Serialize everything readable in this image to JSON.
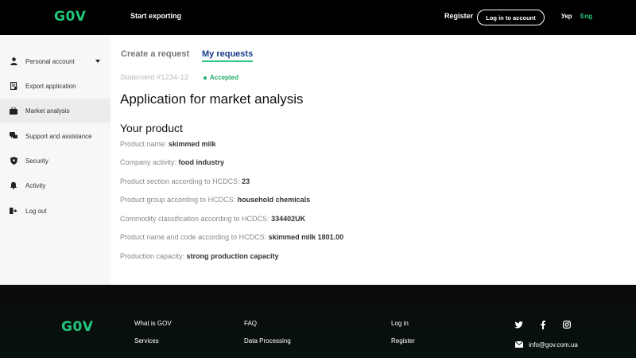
{
  "header": {
    "logo": "G0V",
    "nav_export": "Start exporting",
    "register": "Register",
    "login": "Log in to account",
    "lang_ukr": "Укр",
    "lang_eng": "Eng",
    "accent_color": "#22c47a"
  },
  "sidebar": {
    "items": [
      {
        "label": "Personal account",
        "icon": "person-icon"
      },
      {
        "label": "Export application",
        "icon": "document-icon"
      },
      {
        "label": "Market analysis",
        "icon": "briefcase-icon",
        "active": true
      },
      {
        "label": "Support and assistance",
        "icon": "chat-icon"
      },
      {
        "label": "Security",
        "icon": "shield-icon"
      },
      {
        "label": "Activity",
        "icon": "bell-icon"
      },
      {
        "label": "Log out",
        "icon": "logout-icon"
      }
    ]
  },
  "tabs": {
    "create": "Create a request",
    "my_requests": "My requests"
  },
  "statement": {
    "label": "Statement #1234-12",
    "status": "Accepted",
    "status_color": "#22a86a"
  },
  "page_title": "Application for market analysis",
  "section_title": "Your product",
  "fields": [
    {
      "label": "Product name: ",
      "value": "skimmed milk"
    },
    {
      "label": "Company activity: ",
      "value": "food industry"
    },
    {
      "label": "Product section according to HCDCS: ",
      "value": "23"
    },
    {
      "label": "Product group according to HCDCS: ",
      "value": "household chemicals"
    },
    {
      "label": "Commodity classification according to HCDCS: ",
      "value": "334402UK"
    },
    {
      "label": "Product name and code according to HCDCS: ",
      "value": "skimmed milk 1801.00"
    },
    {
      "label": "Production capacity: ",
      "value": "strong production capacity"
    }
  ],
  "footer": {
    "logo": "G0V",
    "links": {
      "what_is": "What is  GOV",
      "services": "Services",
      "faq": "FAQ",
      "data_processing": "Data Processing",
      "login": "Log in",
      "register": "Register"
    },
    "email": "info@gov.com.ua",
    "socials": [
      "twitter-icon",
      "facebook-icon",
      "instagram-icon"
    ]
  }
}
